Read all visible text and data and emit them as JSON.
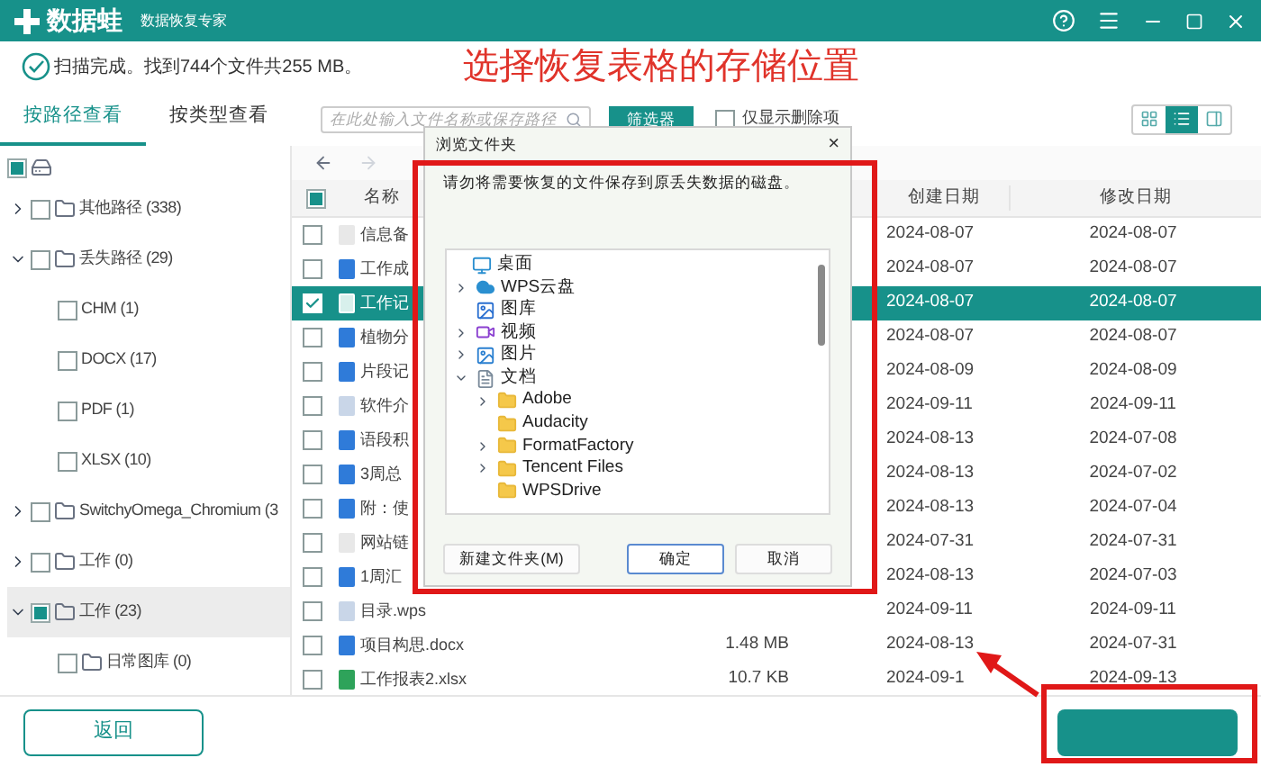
{
  "app": {
    "logo": "数据蛙",
    "subtitle": "数据恢复专家"
  },
  "status": {
    "text": "扫描完成。找到744个文件共255 MB。"
  },
  "annotation": {
    "title": "选择恢复表格的存储位置"
  },
  "view_tabs": [
    {
      "label": "按路径查看",
      "selected": true
    },
    {
      "label": "按类型查看",
      "selected": false
    }
  ],
  "search": {
    "placeholder": "在此处输入文件名称或保存路径"
  },
  "filter_button": "筛选器",
  "deleted_only": {
    "label": "仅显示删除项",
    "checked": false
  },
  "view_modes": [
    {
      "kind": "grid",
      "selected": false
    },
    {
      "kind": "list",
      "selected": true
    },
    {
      "kind": "detail",
      "selected": false
    }
  ],
  "tree": [
    {
      "partial": true,
      "kind": "drive",
      "selected": false,
      "children": [
        {
          "label": "其他路径 (338)",
          "partial": false,
          "kind": "folder",
          "expanded": false,
          "selected": false
        },
        {
          "label": "丢失路径 (29)",
          "partial": false,
          "kind": "folder",
          "expanded": true,
          "selected": false,
          "children": [
            {
              "label": "CHM (1)",
              "partial": false,
              "kind": "type",
              "selected": false
            },
            {
              "label": "DOCX (17)",
              "partial": false,
              "kind": "type",
              "selected": false
            },
            {
              "label": "PDF (1)",
              "partial": false,
              "kind": "type",
              "selected": false
            },
            {
              "label": "XLSX (10)",
              "partial": false,
              "kind": "type",
              "selected": false
            }
          ]
        },
        {
          "label": "SwitchyOmega_Chromium (3",
          "partial": false,
          "kind": "folder",
          "expanded": false,
          "selected": false
        },
        {
          "label": "工作 (0)",
          "partial": false,
          "kind": "folder",
          "expanded": false,
          "selected": false
        },
        {
          "label": "工作 (23)",
          "partial": true,
          "kind": "folder",
          "expanded": true,
          "selected": true,
          "children": [
            {
              "label": "日常图库 (0)",
              "partial": false,
              "kind": "leaf-folder",
              "selected": false
            }
          ]
        }
      ]
    }
  ],
  "table": {
    "header_partial": true,
    "columns": [
      "名称",
      "创建日期",
      "修改日期"
    ],
    "rows": [
      {
        "name": "信息备",
        "kind": "txt",
        "checked": false,
        "selected": false,
        "created": "2024-08-07",
        "modified": "2024-08-07"
      },
      {
        "name": "工作成",
        "kind": "doc",
        "checked": false,
        "selected": false,
        "created": "2024-08-07",
        "modified": "2024-08-07"
      },
      {
        "name": "工作记",
        "kind": "sheet",
        "checked": true,
        "selected": true,
        "created": "2024-08-07",
        "modified": "2024-08-07"
      },
      {
        "name": "植物分",
        "kind": "doc",
        "checked": false,
        "selected": false,
        "created": "2024-08-07",
        "modified": "2024-08-07"
      },
      {
        "name": "片段记",
        "kind": "doc",
        "checked": false,
        "selected": false,
        "created": "2024-08-09",
        "modified": "2024-08-09"
      },
      {
        "name": "软件介",
        "kind": "wps",
        "checked": false,
        "selected": false,
        "created": "2024-09-11",
        "modified": "2024-09-11"
      },
      {
        "name": "语段积",
        "kind": "doc",
        "checked": false,
        "selected": false,
        "created": "2024-08-13",
        "modified": "2024-07-08"
      },
      {
        "name": "3周总",
        "kind": "doc",
        "checked": false,
        "selected": false,
        "created": "2024-08-13",
        "modified": "2024-07-02"
      },
      {
        "name": "附：使",
        "kind": "doc",
        "checked": false,
        "selected": false,
        "created": "2024-08-13",
        "modified": "2024-07-04"
      },
      {
        "name": "网站链",
        "kind": "txt",
        "checked": false,
        "selected": false,
        "created": "2024-07-31",
        "modified": "2024-07-31"
      },
      {
        "name": "1周汇",
        "kind": "doc",
        "checked": false,
        "selected": false,
        "created": "2024-08-13",
        "modified": "2024-07-03"
      },
      {
        "name": "目录.wps",
        "kind": "wps",
        "checked": false,
        "selected": false,
        "created": "2024-09-11",
        "modified": "2024-09-11"
      },
      {
        "name": "项目构思.docx",
        "kind": "doc",
        "checked": false,
        "selected": false,
        "size": "1.48 MB",
        "created": "2024-08-13",
        "modified": "2024-07-31"
      },
      {
        "name": "工作报表2.xlsx",
        "kind": "xlsx",
        "checked": false,
        "selected": false,
        "size": "10.7 KB",
        "created": "2024-09-1",
        "modified": "2024-09-13"
      }
    ]
  },
  "dialog": {
    "title": "浏览文件夹",
    "close": "×",
    "message": "请勿将需要恢复的文件保存到原丢失数据的磁盘。",
    "tree": [
      {
        "label": "桌面",
        "kind": "desktop",
        "children": [
          {
            "label": "WPS云盘",
            "kind": "cloud",
            "expanded": false
          },
          {
            "label": "图库",
            "kind": "gallery"
          },
          {
            "label": "视频",
            "kind": "video",
            "expanded": false
          },
          {
            "label": "图片",
            "kind": "picture",
            "expanded": false
          },
          {
            "label": "文档",
            "kind": "docs",
            "expanded": true,
            "children": [
              {
                "label": "Adobe",
                "kind": "folder",
                "expanded": false
              },
              {
                "label": "Audacity",
                "kind": "folder"
              },
              {
                "label": "FormatFactory",
                "kind": "folder",
                "expanded": false
              },
              {
                "label": "Tencent Files",
                "kind": "folder",
                "expanded": false
              },
              {
                "label": "WPSDrive",
                "kind": "folder"
              }
            ]
          }
        ]
      }
    ],
    "buttons": [
      {
        "label": "新建文件夹(M)",
        "default": false
      },
      {
        "label": "确定",
        "default": true
      },
      {
        "label": "取消",
        "default": false
      }
    ]
  },
  "back_button": "返回"
}
